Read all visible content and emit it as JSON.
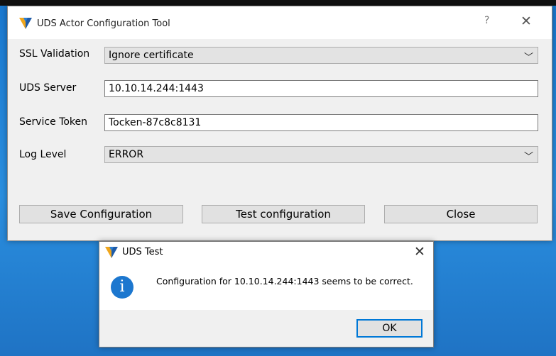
{
  "main_window": {
    "title": "UDS Actor Configuration Tool",
    "help_glyph": "?",
    "close_glyph": "✕",
    "ssl_validation": {
      "label": "SSL Validation",
      "value": "Ignore certificate"
    },
    "uds_server": {
      "label": "UDS Server",
      "value": "10.10.14.244:1443"
    },
    "service_token": {
      "label": "Service Token",
      "value": "Tocken-87c8c8131"
    },
    "log_level": {
      "label": "Log Level",
      "value": "ERROR"
    },
    "buttons": {
      "save": "Save Configuration",
      "test": "Test configuration",
      "close": "Close"
    },
    "icons": [
      "uds-logo-icon",
      "help-icon",
      "close-icon",
      "chevron-down-icon"
    ]
  },
  "test_dialog": {
    "title": "UDS Test",
    "close_glyph": "✕",
    "info_glyph": "i",
    "message": "Configuration for 10.10.14.244:1443 seems to be correct.",
    "ok_label": "OK",
    "icons": [
      "uds-logo-icon",
      "info-icon",
      "close-icon"
    ]
  },
  "colors": {
    "desktop_blue": "#1a78cf",
    "focus_blue": "#0078d7",
    "window_bg": "#f0f0f0"
  }
}
